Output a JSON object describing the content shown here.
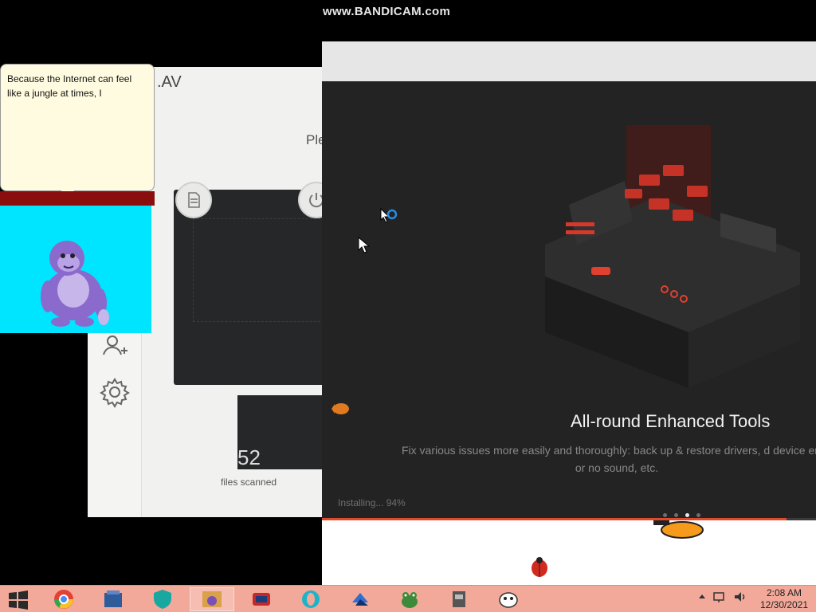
{
  "watermark": "www.BANDICAM.com",
  "antivirus": {
    "title_fragment": ".AV",
    "message_fragment": "Ple",
    "files_scanned_count": "52",
    "files_scanned_label": "files scanned"
  },
  "bonzi": {
    "speech": "Because the Internet can feel like a jungle at times, I"
  },
  "installer": {
    "heading": "All-round Enhanced Tools",
    "description": "Fix various issues more easily and thoroughly: back up & restore drivers, d device error or no sound, etc.",
    "status": "Installing... 94%",
    "progress": 0.94,
    "slides_total": 4,
    "slide_active": 3
  },
  "taskbar": {
    "apps": [
      "windows-start",
      "chrome",
      "file-manager",
      "shield-app",
      "bonzi-app",
      "game-app",
      "opera",
      "stack-app",
      "frog-app",
      "tool-app",
      "penguin-app"
    ],
    "time": "2:08 AM",
    "date": "12/30/2021"
  },
  "colors": {
    "taskbar": "#f3a99a",
    "installer_bg": "#232323",
    "accent_red": "#e04a2a",
    "bonzi_bg": "#00e5ff",
    "bonzi_purple": "#8a6acc"
  }
}
